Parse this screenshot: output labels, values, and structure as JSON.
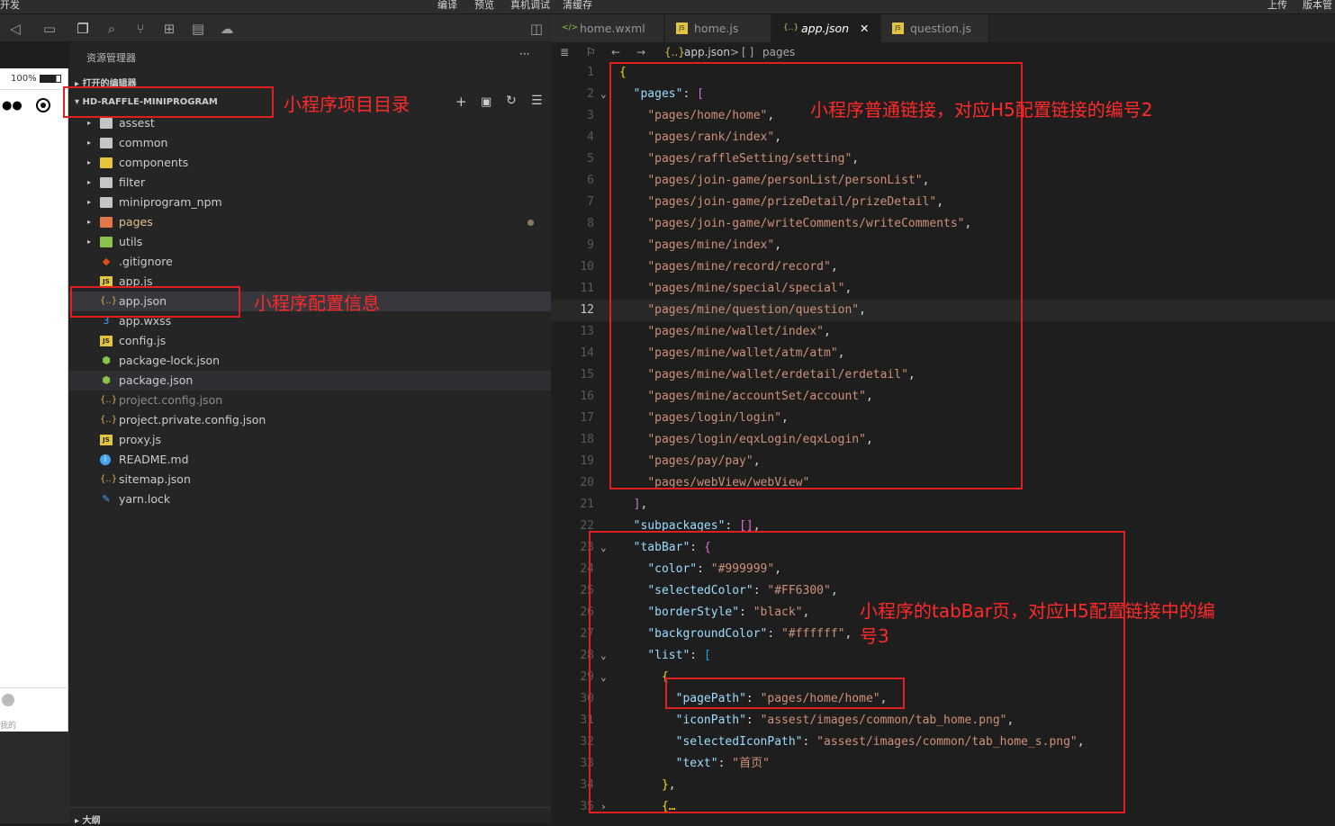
{
  "topbar": {
    "left_label": "开发",
    "center_labels": [
      "编译",
      "预览",
      "真机调试",
      "清缓存"
    ],
    "right_labels": [
      "上传",
      "版本管"
    ]
  },
  "simulator": {
    "zoom": "100%",
    "bottom_label": "我的"
  },
  "explorer": {
    "title": "资源管理器",
    "more": "···",
    "open_editors": "打开的编辑器",
    "project": "HD-RAFFLE-MINIPROGRAM",
    "outline": "大纲",
    "items": [
      {
        "label": "assest",
        "kind": "folder"
      },
      {
        "label": "common",
        "kind": "folder"
      },
      {
        "label": "components",
        "kind": "folder"
      },
      {
        "label": "filter",
        "kind": "folder"
      },
      {
        "label": "miniprogram_npm",
        "kind": "folder"
      },
      {
        "label": "pages",
        "kind": "folder"
      },
      {
        "label": "utils",
        "kind": "folder"
      },
      {
        "label": ".gitignore",
        "kind": "file"
      },
      {
        "label": "app.js",
        "kind": "js"
      },
      {
        "label": "app.json",
        "kind": "json"
      },
      {
        "label": "app.wxss",
        "kind": "file"
      },
      {
        "label": "config.js",
        "kind": "js"
      },
      {
        "label": "package-lock.json",
        "kind": "file"
      },
      {
        "label": "package.json",
        "kind": "file"
      },
      {
        "label": "project.config.json",
        "kind": "json"
      },
      {
        "label": "project.private.config.json",
        "kind": "json"
      },
      {
        "label": "proxy.js",
        "kind": "js"
      },
      {
        "label": "README.md",
        "kind": "file"
      },
      {
        "label": "sitemap.json",
        "kind": "json"
      },
      {
        "label": "yarn.lock",
        "kind": "file"
      }
    ]
  },
  "tabs": [
    {
      "label": "home.wxml",
      "icon": "</>"
    },
    {
      "label": "home.js",
      "icon": "JS"
    },
    {
      "label": "app.json",
      "icon": "{..}"
    },
    {
      "label": "question.js",
      "icon": "JS"
    }
  ],
  "tab_close": "✕",
  "breadcrumb": {
    "file_icon": "{..}",
    "file": "app.json",
    "sep": ">",
    "node_icon": "[ ]",
    "node": "pages"
  },
  "code": {
    "line_numbers": [
      "1",
      "2",
      "3",
      "4",
      "5",
      "6",
      "7",
      "8",
      "9",
      "10",
      "11",
      "12",
      "13",
      "14",
      "15",
      "16",
      "17",
      "18",
      "19",
      "20",
      "21",
      "22",
      "23",
      "24",
      "25",
      "26",
      "27",
      "28",
      "29",
      "30",
      "31",
      "32",
      "33",
      "34",
      "35"
    ],
    "pages": [
      "pages/home/home",
      "pages/rank/index",
      "pages/raffleSetting/setting",
      "pages/join-game/personList/personList",
      "pages/join-game/prizeDetail/prizeDetail",
      "pages/join-game/writeComments/writeComments",
      "pages/mine/index",
      "pages/mine/record/record",
      "pages/mine/special/special",
      "pages/mine/question/question",
      "pages/mine/wallet/index",
      "pages/mine/wallet/atm/atm",
      "pages/mine/wallet/erdetail/erdetail",
      "pages/mine/accountSet/account",
      "pages/login/login",
      "pages/login/eqxLogin/eqxLogin",
      "pages/pay/pay",
      "pages/webView/webView"
    ],
    "keys": {
      "pages": "pages",
      "subpackages": "subpackages",
      "tabBar": "tabBar",
      "color": "color",
      "selectedColor": "selectedColor",
      "borderStyle": "borderStyle",
      "backgroundColor": "backgroundColor",
      "list": "list",
      "pagePath": "pagePath",
      "iconPath": "iconPath",
      "selectedIconPath": "selectedIconPath",
      "text": "text"
    },
    "values": {
      "color": "#999999",
      "selectedColor": "#FF6300",
      "borderStyle": "black",
      "backgroundColor": "#ffffff",
      "pagePath": "pages/home/home",
      "iconPath": "assest/images/common/tab_home.png",
      "selectedIconPath": "assest/images/common/tab_home_s.png",
      "text": "首页"
    },
    "collapsed": "{…"
  },
  "annotations": {
    "project_dir": "小程序项目目录",
    "config_info": "小程序配置信息",
    "normal_links": "小程序普通链接，对应H5配置链接的编号2",
    "tabbar_line1": "小程序的tabBar页，对应H5配置链接中的编",
    "tabbar_line2": "号3"
  },
  "colors": {
    "annotation_red": "#e02020"
  }
}
